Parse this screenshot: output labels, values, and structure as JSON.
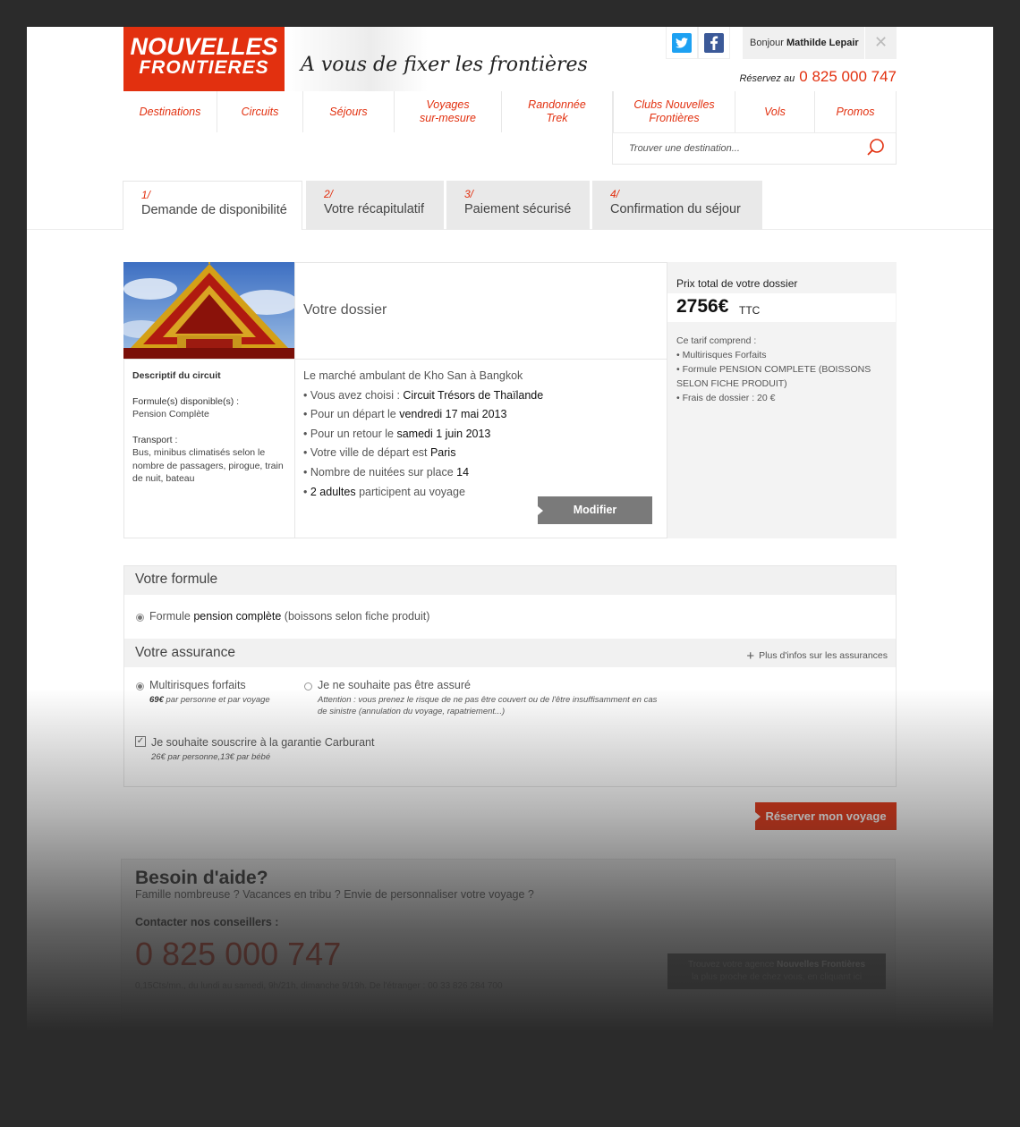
{
  "header": {
    "logo_line1": "NOUVELLES",
    "logo_line2": "FRONTIERES",
    "slogan": "A vous de fixer les frontières",
    "greeting_prefix": "Bonjour",
    "user_name": "Mathilde Lepair",
    "reserve_label": "Réservez au",
    "reserve_phone": "0 825 000 747",
    "social": {
      "twitter_icon": "twitter-icon",
      "facebook_icon": "facebook-icon",
      "twitter_color": "#1da1f2",
      "facebook_color": "#3b5998"
    },
    "close_icon": "close-icon"
  },
  "nav": {
    "items": [
      {
        "line1": "Destinations",
        "line2": ""
      },
      {
        "line1": "Circuits",
        "line2": ""
      },
      {
        "line1": "Séjours",
        "line2": ""
      },
      {
        "line1": "Voyages",
        "line2": "sur-mesure"
      },
      {
        "line1": "Randonnée",
        "line2": "Trek"
      },
      {
        "line1": "Clubs Nouvelles",
        "line2": "Frontières"
      },
      {
        "line1": "Vols",
        "line2": ""
      },
      {
        "line1": "Promos",
        "line2": ""
      }
    ],
    "search_placeholder": "Trouver une destination...",
    "search_icon": "search-icon"
  },
  "steps": [
    {
      "num": "1/",
      "label": "Demande de disponibilité",
      "active": true
    },
    {
      "num": "2/",
      "label": "Votre récapitulatif",
      "active": false
    },
    {
      "num": "3/",
      "label": "Paiement sécurisé",
      "active": false
    },
    {
      "num": "4/",
      "label": "Confirmation du séjour",
      "active": false
    }
  ],
  "dossier": {
    "title": "Votre dossier",
    "photo_icon": "temple-photo",
    "circuit_heading": "Descriptif du circuit",
    "formule_label": "Formule(s) disponible(s) :",
    "formule_value": "Pension Complète",
    "transport_label": "Transport :",
    "transport_value": "Bus, minibus climatisés selon le nombre de passagers, pirogue, train de nuit, bateau",
    "intro": "Le marché ambulant de Kho San à Bangkok",
    "lines": [
      {
        "pre": "Vous avez choisi : ",
        "val": "Circuit Trésors de Thaïlande",
        "post": ""
      },
      {
        "pre": "Pour un départ le ",
        "val": "vendredi 17 mai 2013",
        "post": ""
      },
      {
        "pre": "Pour un retour le ",
        "val": "samedi 1 juin 2013",
        "post": ""
      },
      {
        "pre": "Votre ville de départ est ",
        "val": "Paris",
        "post": ""
      },
      {
        "pre": "Nombre de nuitées sur place ",
        "val": "14",
        "post": ""
      },
      {
        "pre": "",
        "val": "2 adultes",
        "post": " participent au voyage"
      }
    ],
    "modify_label": "Modifier"
  },
  "price": {
    "heading": "Prix total de votre dossier",
    "value": "2756€",
    "ttc": "TTC",
    "includes_label": "Ce tarif comprend :",
    "includes": [
      "• Multirisques Forfaits",
      "• Formule PENSION COMPLETE (BOISSONS SELON FICHE PRODUIT)",
      "• Frais de dossier : 20 €"
    ]
  },
  "formule": {
    "title": "Votre formule",
    "option_pre": "Formule ",
    "option_val": "pension complète",
    "option_post": " (boissons selon fiche produit)"
  },
  "assurance": {
    "title": "Votre assurance",
    "more_info": "Plus d'infos sur les assurances",
    "plus_icon": "plus-icon",
    "opt1_label": "Multirisques forfaits",
    "opt1_price": "69€",
    "opt1_note": " par personne et par voyage",
    "opt2_label": "Je ne souhaite pas être assuré",
    "opt2_note": "Attention : vous prenez le risque de ne pas être couvert ou de l'être insuffisamment en cas de sinistre (annulation du voyage, rapatriement...)",
    "fuel_label": "Je souhaite souscrire à la garantie Carburant",
    "fuel_note": "26€ par personne,13€ par bébé"
  },
  "book_label": "Réserver mon voyage",
  "help": {
    "title": "Besoin d'aide?",
    "subtitle": "Famille nombreuse ? Vacances en tribu ? Envie de personnaliser votre voyage ?",
    "contact": "Contacter nos conseillers :",
    "phone": "0 825 000 747",
    "hours": "0,15Cts/mn., du lundi au samedi, 9h/21h, dimanche 9/19h. De l'étranger : 00 33 826 284 700",
    "agency_pre": "Trouvez votre agence ",
    "agency_brand": "Nouvelles Frontières",
    "agency_post": "la plus proche de chez vous, en cliquant ici"
  },
  "colors": {
    "brand": "#e2300f",
    "grey_button": "#7a7a7a",
    "page_bg": "#2b2b2b"
  }
}
